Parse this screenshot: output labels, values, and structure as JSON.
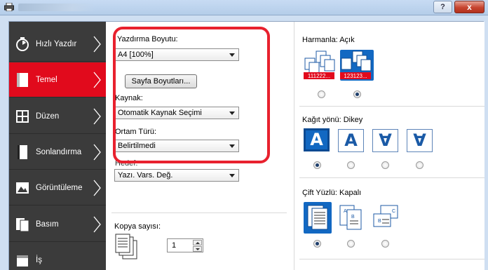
{
  "window": {
    "help_glyph": "?",
    "close_glyph": "x"
  },
  "sidebar": {
    "items": [
      {
        "label": "Hızlı Yazdır",
        "icon": "stopwatch-icon"
      },
      {
        "label": "Temel",
        "icon": "page-icon",
        "active": true
      },
      {
        "label": "Düzen",
        "icon": "layout-icon"
      },
      {
        "label": "Sonlandırma",
        "icon": "finishing-icon"
      },
      {
        "label": "Görüntüleme",
        "icon": "image-icon"
      },
      {
        "label": "Basım",
        "icon": "publishing-icon"
      },
      {
        "label": "İş",
        "icon": "job-icon"
      }
    ]
  },
  "basic": {
    "print_size_label": "Yazdırma Boyutu:",
    "print_size_value": "A4  [100%]",
    "page_sizes_button": "Sayfa Boyutları...",
    "source_label": "Kaynak:",
    "source_value": "Otomatik Kaynak Seçimi",
    "media_label": "Ortam Türü:",
    "media_value": "Belirtilmedi",
    "destination_label": "Hedef:",
    "destination_value": "Yazı. Vars. Değ.",
    "copies_label": "Kopya sayısı:",
    "copies_value": "1"
  },
  "collate": {
    "label": "Harmanla:",
    "state": "Açık",
    "options": [
      {
        "name": "uncollated",
        "caption": "111222...",
        "selected": false
      },
      {
        "name": "collated",
        "caption": "123123...",
        "selected": true
      }
    ]
  },
  "orientation": {
    "label": "Kağıt yönü:",
    "state": "Dikey",
    "options": [
      {
        "glyph": "A",
        "selected": true
      },
      {
        "glyph": "A",
        "selected": false
      },
      {
        "glyph": "∀",
        "selected": false
      },
      {
        "glyph": "∀",
        "selected": false
      }
    ]
  },
  "duplex": {
    "label": "Çift Yüzlü:",
    "state": "Kapalı",
    "options": [
      {
        "name": "single-sided",
        "selected": true
      },
      {
        "name": "long-edge",
        "selected": false
      },
      {
        "name": "short-edge",
        "selected": false
      }
    ]
  },
  "colors": {
    "accent_red": "#e10a1c",
    "sidebar_bg": "#3b3b3b",
    "select_blue": "#1268c2",
    "callout_red": "#e8212e"
  }
}
